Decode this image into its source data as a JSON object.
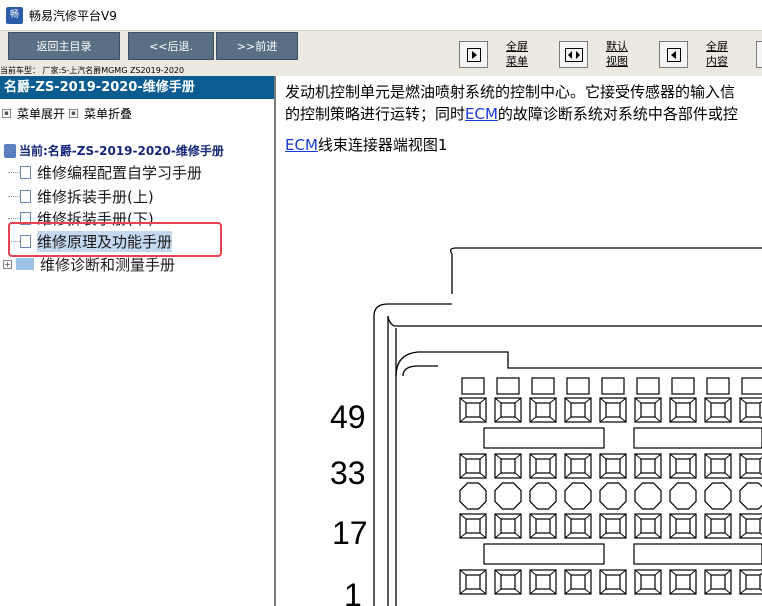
{
  "app": {
    "title": "畅易汽修平台V9",
    "icon_label": "app-icon"
  },
  "toolbar": {
    "back_main": "返回主目录",
    "back": "<<后退.",
    "forward": ">>前进",
    "vehicle": "当前车型：  厂家:S-上汽名爵MGMG ZS2019-2020",
    "full_menu_1": "全屏",
    "full_menu_2": "菜单",
    "default_view_1": "默认",
    "default_view_2": "视图",
    "full_content_1": "全屏",
    "full_content_2": "内容"
  },
  "sidebar": {
    "header": "名爵-ZS-2019-2020-维修手册",
    "expand_label": "菜单展开",
    "collapse_label": "菜单折叠",
    "current": "当前:名爵-ZS-2019-2020-维修手册",
    "items": [
      {
        "label": "维修编程配置自学习手册"
      },
      {
        "label": "维修拆装手册(上)"
      },
      {
        "label": "维修拆装手册(下)"
      },
      {
        "label": "维修原理及功能手册"
      },
      {
        "label": "维修诊断和测量手册"
      }
    ]
  },
  "content": {
    "line1": "发动机控制单元是燃油喷射系统的控制中心。它接受传感器的输入信",
    "line2_a": "的控制策略进行运转；同时",
    "line2_link": "ECM",
    "line2_b": "的故障诊断系统对系统中各部件或控",
    "diagram_link": "ECM",
    "diagram_title": "线束连接器端视图1",
    "pin_labels": [
      "49",
      "33",
      "17",
      "1"
    ]
  },
  "colors": {
    "nav_button": "#5a6f83",
    "header_blue": "#0a5c91",
    "link_blue": "#1a3bd8",
    "highlight_red": "#e8414f"
  }
}
